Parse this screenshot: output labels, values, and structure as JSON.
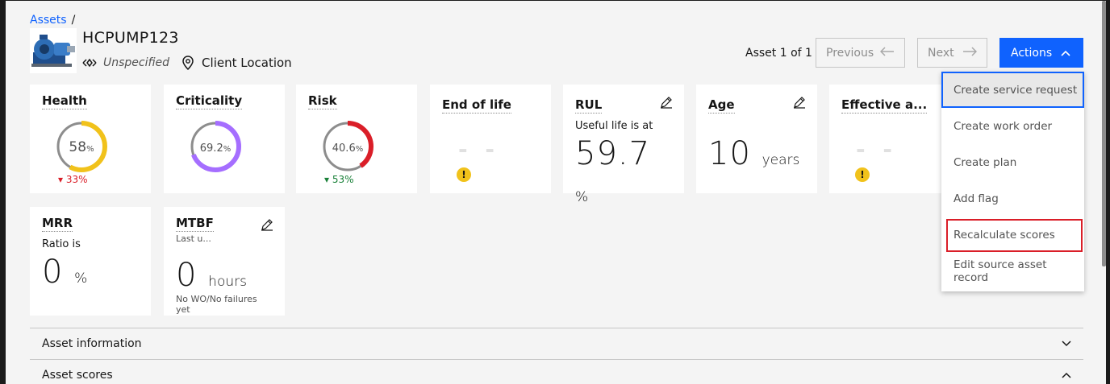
{
  "breadcrumb": {
    "root": "Assets",
    "separator": "/"
  },
  "asset": {
    "name": "HCPUMP123",
    "type": "Unspecified",
    "location": "Client Location"
  },
  "pager": {
    "status": "Asset 1 of 1",
    "previous": "Previous",
    "next": "Next",
    "actions": "Actions"
  },
  "cards": {
    "health": {
      "title": "Health",
      "value": "58",
      "unit": "%",
      "percent": 58,
      "delta": "33%",
      "delta_dir": "down",
      "color": "#f1c21b"
    },
    "criticality": {
      "title": "Criticality",
      "value": "69.2",
      "unit": "%",
      "percent": 69.2,
      "color": "#a56eff"
    },
    "risk": {
      "title": "Risk",
      "value": "40.6",
      "unit": "%",
      "percent": 40.6,
      "delta": "53%",
      "delta_dir": "up",
      "color": "#da1e28"
    },
    "end_of_life": {
      "title": "End of life",
      "value": "- -"
    },
    "rul": {
      "title": "RUL",
      "sub": "Useful life is at",
      "value": "59.7",
      "unit": "%"
    },
    "age": {
      "title": "Age",
      "value": "10",
      "unit": "years"
    },
    "effective": {
      "title": "Effective a...",
      "value": "- -"
    },
    "mrr": {
      "title": "MRR",
      "sub": "Ratio is",
      "value": "0",
      "unit": "%"
    },
    "mtbf": {
      "title": "MTBF",
      "sub": "Last u...",
      "value": "0",
      "unit": "hours",
      "footnote": "No WO/No failures yet"
    }
  },
  "actions_menu": [
    "Create service request",
    "Create work order",
    "Create plan",
    "Add flag",
    "Recalculate scores",
    "Edit source asset record"
  ],
  "accordions": {
    "info": "Asset information",
    "scores": "Asset scores"
  },
  "colors": {
    "accent": "#0f62fe",
    "donut_track": "#8d8d8d"
  }
}
